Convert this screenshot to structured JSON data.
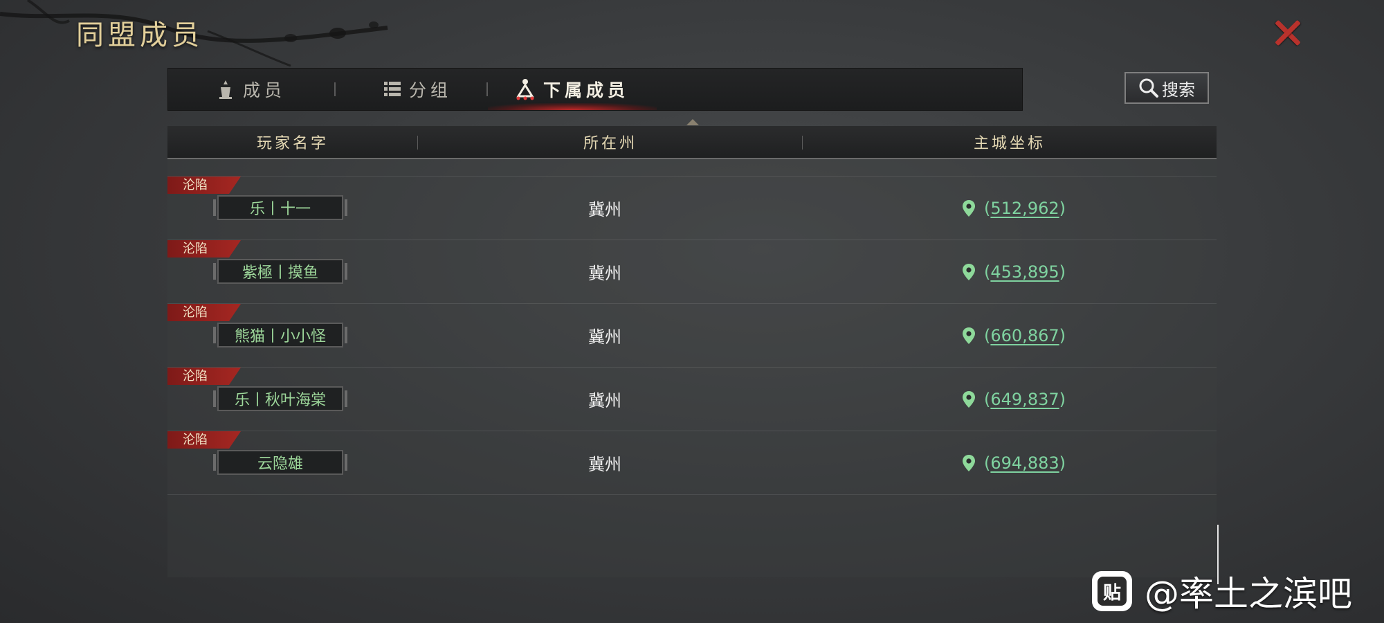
{
  "window": {
    "title": "同盟成员",
    "close_icon": "close-icon"
  },
  "tabs": [
    {
      "label": "成员",
      "icon": "members-icon",
      "active": false
    },
    {
      "label": "分组",
      "icon": "list-icon",
      "active": false
    },
    {
      "label": "下属成员",
      "icon": "subordinate-icon",
      "active": true
    }
  ],
  "search": {
    "label": "搜索",
    "icon": "search-icon"
  },
  "table": {
    "columns": [
      "玩家名字",
      "所在州",
      "主城坐标"
    ],
    "rows": [
      {
        "tag": "沦陷",
        "name": "乐丨十一",
        "state": "冀州",
        "coord": "512,962"
      },
      {
        "tag": "沦陷",
        "name": "紫極丨摸鱼",
        "state": "冀州",
        "coord": "453,895"
      },
      {
        "tag": "沦陷",
        "name": "熊猫丨小小怪",
        "state": "冀州",
        "coord": "660,867"
      },
      {
        "tag": "沦陷",
        "name": "乐丨秋叶海棠",
        "state": "冀州",
        "coord": "649,837"
      },
      {
        "tag": "沦陷",
        "name": "云隐雄",
        "state": "冀州",
        "coord": "694,883"
      }
    ]
  },
  "watermark": {
    "icon_text": "贴",
    "text": "@率土之滨吧"
  },
  "colors": {
    "title_gold": "#e2cf9a",
    "tag_red": "#a52722",
    "name_green": "#9dd79a",
    "coord_green": "#7fd3a0",
    "close_red": "#b8322c"
  }
}
